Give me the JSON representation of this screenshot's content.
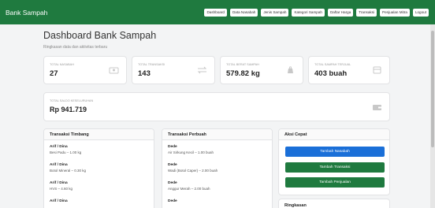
{
  "app": {
    "brand": "Bank Sampah"
  },
  "nav": [
    "Dashboard",
    "Data Nasabah",
    "Jenis Sampah",
    "Kategori Sampah",
    "Daftar Harga",
    "Transaksi",
    "Penjualan Mitra",
    "Logout"
  ],
  "page": {
    "title": "Dashboard Bank Sampah",
    "subtitle": "Ringkasan data dan aktivitas terbaru"
  },
  "stats": [
    {
      "label": "Total Nasabah",
      "value": "27",
      "icon": "users-icon"
    },
    {
      "label": "Total Transaksi",
      "value": "143",
      "icon": "exchange-icon"
    },
    {
      "label": "Total Berat Sampah",
      "value": "579.82 kg",
      "icon": "weight-icon"
    },
    {
      "label": "Total Sampah Terjual",
      "value": "403 buah",
      "icon": "box-icon"
    }
  ],
  "total_card": {
    "label": "Total Saldo Keseluruhan",
    "value": "Rp 941.719",
    "icon": "wallet-icon"
  },
  "transaksi_timbang": {
    "title": "Transaksi Timbang",
    "items": [
      {
        "name": "Arif / Dina",
        "desc": "Besi Padu – 1.00 kg"
      },
      {
        "name": "Arif / Dina",
        "desc": "Botol Mineral – 0.30 kg"
      },
      {
        "name": "Arif / Dina",
        "desc": "HVS – 4.60 kg"
      },
      {
        "name": "Arif / Dina",
        "desc": ""
      }
    ]
  },
  "transaksi_perbuah": {
    "title": "Transaksi Perbuah",
    "items": [
      {
        "name": "Dede",
        "desc": "Air Sirkung Kecil – 1.00 buah"
      },
      {
        "name": "Dede",
        "desc": "Wadi (Botol Caper) – 2.00 buah"
      },
      {
        "name": "Dede",
        "desc": "Anggur Merah – 2.00 buah"
      },
      {
        "name": "Dede",
        "desc": ""
      }
    ]
  },
  "aksi_cepat": {
    "title": "Aksi Cepat",
    "buttons": [
      {
        "label": "Tambah Nasabah",
        "color": "#1a6fd8"
      },
      {
        "label": "Tambah Transaksi",
        "color": "#1f7a3f"
      },
      {
        "label": "Tambah Penjualan",
        "color": "#1f7a3f"
      }
    ]
  },
  "ringkasan": {
    "title": "Ringkasan"
  },
  "colors": {
    "primary": "#1f7a3f",
    "accent": "#1a6fd8"
  }
}
